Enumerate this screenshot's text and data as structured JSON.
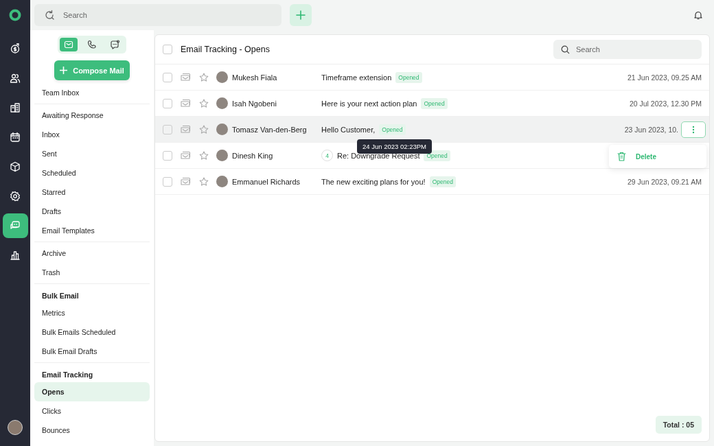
{
  "rail": {
    "items": [
      {
        "selected": false
      },
      {
        "selected": false
      },
      {
        "selected": false
      },
      {
        "selected": false
      },
      {
        "selected": false
      },
      {
        "selected": false
      },
      {
        "selected": true
      },
      {
        "selected": false
      }
    ]
  },
  "topbar": {
    "search": {
      "placeholder": "Search"
    }
  },
  "channel_tabs": [
    {
      "selected": true
    },
    {
      "selected": false
    },
    {
      "selected": false
    }
  ],
  "compose_button": "Compose Mail",
  "sidebar": {
    "groups": [
      {
        "items": [
          {
            "label": "Team Inbox",
            "selected": false
          }
        ]
      },
      {
        "items": [
          {
            "label": "Awaiting Response",
            "selected": false
          },
          {
            "label": "Inbox",
            "selected": false
          },
          {
            "label": "Sent",
            "selected": false
          },
          {
            "label": "Scheduled",
            "selected": false
          },
          {
            "label": "Starred",
            "selected": false
          },
          {
            "label": "Drafts",
            "selected": false
          },
          {
            "label": "Email Templates",
            "selected": false
          }
        ]
      },
      {
        "items": [
          {
            "label": "Archive",
            "selected": false
          },
          {
            "label": "Trash",
            "selected": false
          }
        ]
      },
      {
        "heading": "Bulk Email",
        "items": [
          {
            "label": "Metrics",
            "selected": false
          },
          {
            "label": "Bulk Emails Scheduled",
            "selected": false
          },
          {
            "label": "Bulk Email Drafts",
            "selected": false
          }
        ]
      },
      {
        "heading": "Email Tracking",
        "items": [
          {
            "label": "Opens",
            "selected": true
          },
          {
            "label": "Clicks",
            "selected": false
          },
          {
            "label": "Bounces",
            "selected": false
          }
        ]
      }
    ]
  },
  "list": {
    "title": "Email Tracking - Opens",
    "checked": false,
    "search": {
      "placeholder": "Search"
    },
    "rows": [
      {
        "name": "Mukesh Fiala",
        "subject": "Timeframe extension",
        "status": "Opened",
        "date": "21 Jun 2023, 09.25 AM",
        "checked": false,
        "starred": false,
        "hovered": false
      },
      {
        "name": "Isah Ngobeni",
        "subject": "Here is your next action plan",
        "status": "Opened",
        "date": "20 Jul 2023, 12.30 PM",
        "checked": false,
        "starred": false,
        "hovered": false
      },
      {
        "name": "Tomasz Van-den-Berg",
        "subject": "Hello Customer,",
        "status": "Opened",
        "date": "23 Jun 2023, 10.",
        "checked": false,
        "starred": false,
        "hovered": true,
        "tooltip": "24 Jun 2023 02:23PM",
        "menu": [
          {
            "label": "Delete"
          }
        ]
      },
      {
        "name": "Dinesh King",
        "thread_count": "4",
        "subject": "Re: Downgrade Request",
        "status": "Opened",
        "date": "",
        "checked": false,
        "starred": false,
        "hovered": false
      },
      {
        "name": "Emmanuel Richards",
        "subject": "The new exciting plans for you!",
        "status": "Opened",
        "date": "29 Jun 2023, 09.21 AM",
        "checked": false,
        "starred": false,
        "hovered": false
      }
    ],
    "total": "Total : 05"
  }
}
